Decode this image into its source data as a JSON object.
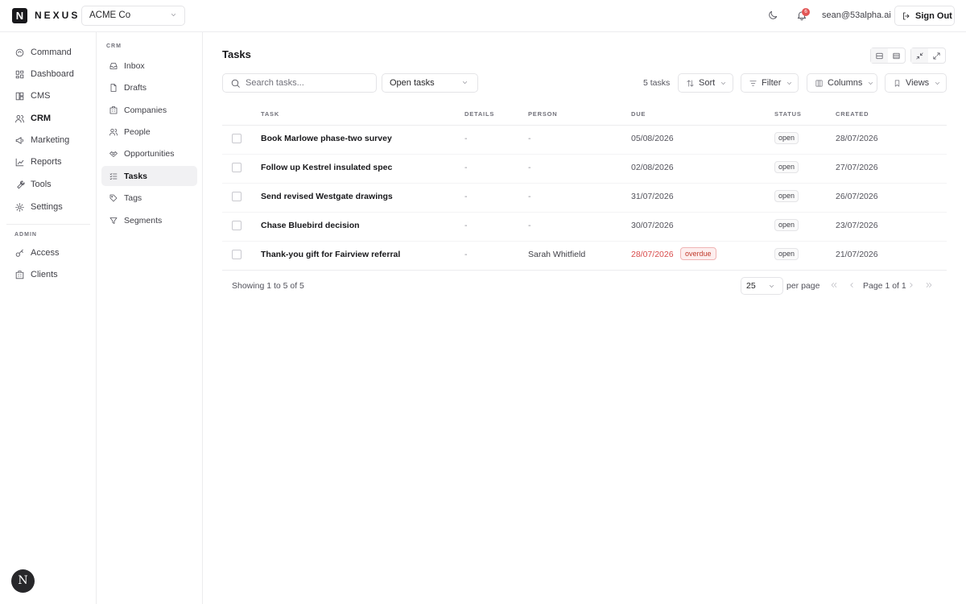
{
  "header": {
    "logo_letter": "N",
    "brand": "NEXUS",
    "org": "ACME Co",
    "notification_count": "6",
    "user_email": "sean@53alpha.ai",
    "sign_out_label": "Sign Out"
  },
  "sidebar": {
    "items": [
      {
        "label": "Command",
        "icon": "command-icon"
      },
      {
        "label": "Dashboard",
        "icon": "dashboard-icon"
      },
      {
        "label": "CMS",
        "icon": "cms-icon"
      },
      {
        "label": "CRM",
        "icon": "users-icon",
        "active": true
      },
      {
        "label": "Marketing",
        "icon": "megaphone-icon"
      },
      {
        "label": "Reports",
        "icon": "chart-icon"
      },
      {
        "label": "Tools",
        "icon": "wrench-icon"
      },
      {
        "label": "Settings",
        "icon": "gear-icon"
      }
    ],
    "admin_section": "ADMIN",
    "admin_items": [
      {
        "label": "Access",
        "icon": "key-icon"
      },
      {
        "label": "Clients",
        "icon": "building-icon"
      }
    ],
    "avatar_letter": "N"
  },
  "subnav": {
    "section": "CRM",
    "items": [
      {
        "label": "Inbox",
        "icon": "inbox-icon"
      },
      {
        "label": "Drafts",
        "icon": "file-icon"
      },
      {
        "label": "Companies",
        "icon": "building-icon"
      },
      {
        "label": "People",
        "icon": "people-icon"
      },
      {
        "label": "Opportunities",
        "icon": "handshake-icon"
      },
      {
        "label": "Tasks",
        "icon": "tasklist-icon",
        "active": true
      },
      {
        "label": "Tags",
        "icon": "tag-icon"
      },
      {
        "label": "Segments",
        "icon": "funnel-icon"
      }
    ]
  },
  "main": {
    "title": "Tasks",
    "search_placeholder": "Search tasks...",
    "filter_value": "Open tasks",
    "task_count": "5 tasks",
    "sort_label": "Sort",
    "filter_label": "Filter",
    "columns_label": "Columns",
    "views_label": "Views"
  },
  "table": {
    "headers": [
      "TASK",
      "DETAILS",
      "PERSON",
      "DUE",
      "STATUS",
      "CREATED"
    ],
    "rows": [
      {
        "task": "Book Marlowe phase-two survey",
        "details": "-",
        "person": "-",
        "due": "05/08/2026",
        "overdue": "",
        "status": "open",
        "created": "28/07/2026"
      },
      {
        "task": "Follow up Kestrel insulated spec",
        "details": "-",
        "person": "-",
        "due": "02/08/2026",
        "overdue": "",
        "status": "open",
        "created": "27/07/2026"
      },
      {
        "task": "Send revised Westgate drawings",
        "details": "-",
        "person": "-",
        "due": "31/07/2026",
        "overdue": "",
        "status": "open",
        "created": "26/07/2026"
      },
      {
        "task": "Chase Bluebird decision",
        "details": "-",
        "person": "-",
        "due": "30/07/2026",
        "overdue": "",
        "status": "open",
        "created": "23/07/2026"
      },
      {
        "task": "Thank-you gift for Fairview referral",
        "details": "-",
        "person": "Sarah Whitfield",
        "due": "28/07/2026",
        "overdue": "overdue",
        "status": "open",
        "created": "21/07/2026"
      }
    ]
  },
  "footer": {
    "showing": "Showing 1 to 5 of 5",
    "per_page_value": "25",
    "per_page_label": "per page",
    "page_label": "Page 1 of 1"
  },
  "colors": {
    "overdue": "#d94b4b",
    "badge": "#e25555",
    "text": "#18181b"
  }
}
